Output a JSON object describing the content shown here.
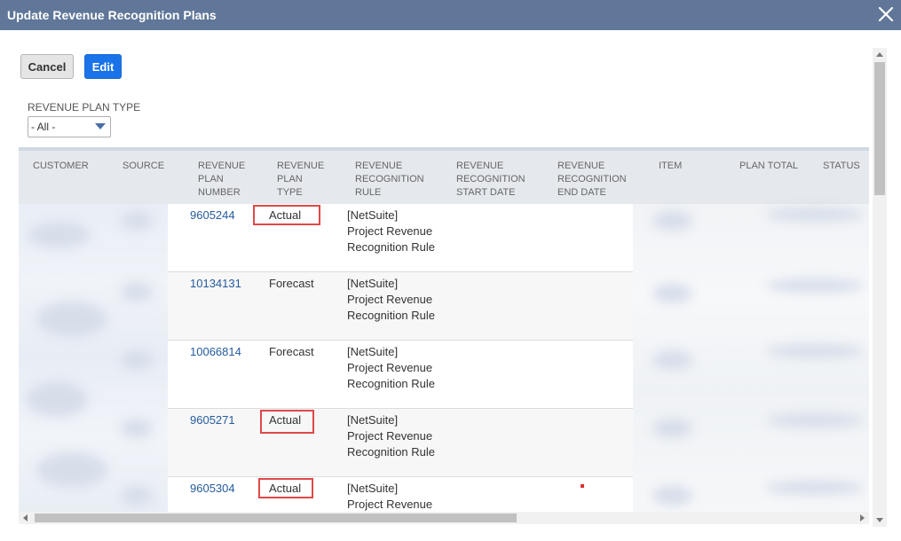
{
  "dialog": {
    "title": "Update Revenue Recognition Plans"
  },
  "toolbar": {
    "cancel_label": "Cancel",
    "edit_label": "Edit"
  },
  "filter": {
    "label": "REVENUE PLAN TYPE",
    "selected": "- All -"
  },
  "table": {
    "headers": {
      "customer": "CUSTOMER",
      "source": "SOURCE",
      "plan_number": "REVENUE\nPLAN\nNUMBER",
      "plan_type": "REVENUE\nPLAN\nTYPE",
      "rec_rule": "REVENUE\nRECOGNITION\nRULE",
      "start_date": "REVENUE\nRECOGNITION\nSTART DATE",
      "end_date": "REVENUE\nRECOGNITION\nEND DATE",
      "item": "ITEM",
      "plan_total": "PLAN TOTAL",
      "status": "STATUS"
    },
    "rows": [
      {
        "plan_number": "9605244",
        "plan_type": "Actual",
        "rule": "[NetSuite]\nProject Revenue\nRecognition Rule"
      },
      {
        "plan_number": "10134131",
        "plan_type": "Forecast",
        "rule": "[NetSuite]\nProject Revenue\nRecognition Rule"
      },
      {
        "plan_number": "10066814",
        "plan_type": "Forecast",
        "rule": "[NetSuite]\nProject Revenue\nRecognition Rule"
      },
      {
        "plan_number": "9605271",
        "plan_type": "Actual",
        "rule": "[NetSuite]\nProject Revenue\nRecognition Rule"
      },
      {
        "plan_number": "9605304",
        "plan_type": "Actual",
        "rule": "[NetSuite]\nProject Revenue\nRecognition Rule"
      }
    ]
  },
  "colors": {
    "titlebar": "#607799",
    "primary_button": "#1a73e8",
    "link": "#255ba0",
    "highlight": "#e04848"
  }
}
